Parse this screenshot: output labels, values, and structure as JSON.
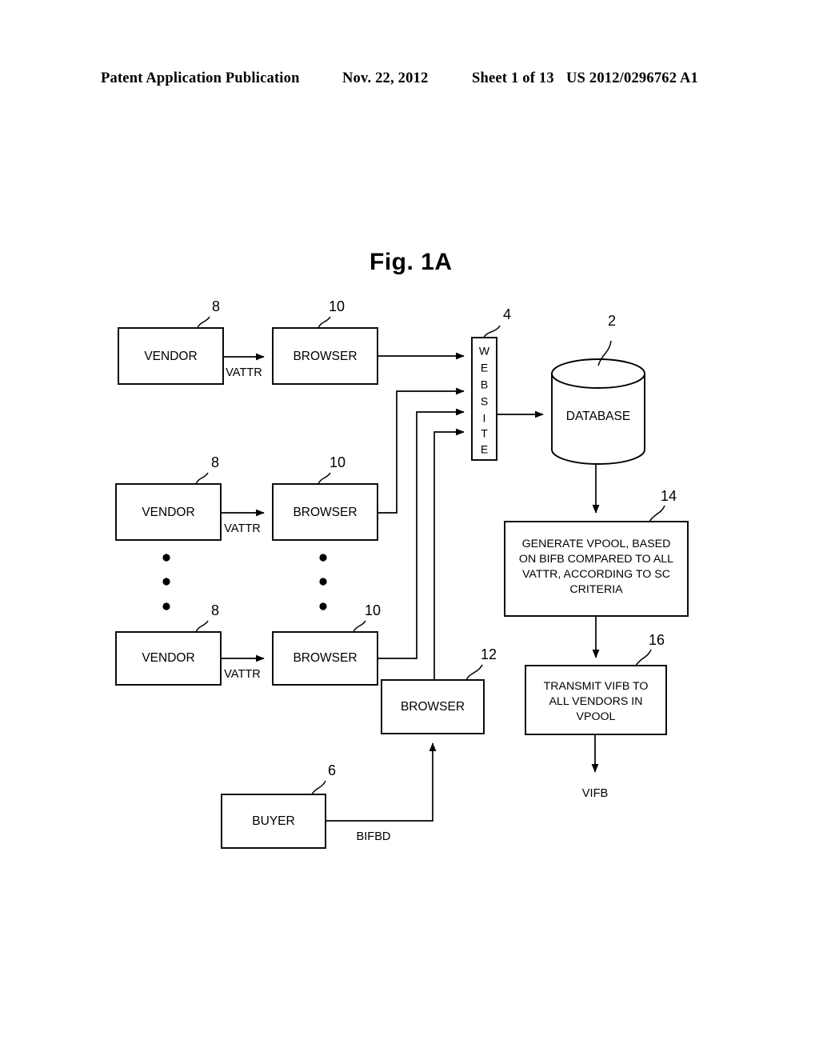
{
  "header": {
    "publication": "Patent Application Publication",
    "date": "Nov. 22, 2012",
    "sheet": "Sheet 1 of 13",
    "patent_number": "US 2012/0296762 A1"
  },
  "figure": {
    "title": "Fig. 1A",
    "nodes": {
      "vendor1": {
        "label": "VENDOR",
        "ref": "8"
      },
      "vendor2": {
        "label": "VENDOR",
        "ref": "8"
      },
      "vendor3": {
        "label": "VENDOR",
        "ref": "8"
      },
      "browser1": {
        "label": "BROWSER",
        "ref": "10"
      },
      "browser2": {
        "label": "BROWSER",
        "ref": "10"
      },
      "browser3": {
        "label": "BROWSER",
        "ref": "10"
      },
      "browser_buyer": {
        "label": "BROWSER",
        "ref": "12"
      },
      "website": {
        "label": "WEBSITE",
        "ref": "4"
      },
      "database": {
        "label": "DATABASE",
        "ref": "2"
      },
      "buyer": {
        "label": "BUYER",
        "ref": "6"
      },
      "generate_vpool": {
        "ref": "14",
        "lines": [
          "GENERATE VPOOL, BASED",
          "ON BIFB COMPARED TO ALL",
          "VATTR, ACCORDING TO SC",
          "CRITERIA"
        ]
      },
      "transmit_vifb": {
        "ref": "16",
        "lines": [
          "TRANSMIT VIFB TO",
          "ALL VENDORS IN",
          "VPOOL"
        ]
      }
    },
    "edge_labels": {
      "vattr1": "VATTR",
      "vattr2": "VATTR",
      "vattr3": "VATTR",
      "bifbd": "BIFBD",
      "vifb_out": "VIFB"
    },
    "website_letters": [
      "W",
      "E",
      "B",
      "S",
      "I",
      "T",
      "E"
    ]
  },
  "chart_data": {
    "type": "diagram",
    "title": "Fig. 1A",
    "nodes": [
      {
        "id": "8a",
        "label": "VENDOR",
        "ref": "8",
        "shape": "rect"
      },
      {
        "id": "10a",
        "label": "BROWSER",
        "ref": "10",
        "shape": "rect"
      },
      {
        "id": "8b",
        "label": "VENDOR",
        "ref": "8",
        "shape": "rect"
      },
      {
        "id": "10b",
        "label": "BROWSER",
        "ref": "10",
        "shape": "rect"
      },
      {
        "id": "8c",
        "label": "VENDOR",
        "ref": "8",
        "shape": "rect"
      },
      {
        "id": "10c",
        "label": "BROWSER",
        "ref": "10",
        "shape": "rect"
      },
      {
        "id": "12",
        "label": "BROWSER",
        "ref": "12",
        "shape": "rect"
      },
      {
        "id": "6",
        "label": "BUYER",
        "ref": "6",
        "shape": "rect"
      },
      {
        "id": "4",
        "label": "WEBSITE",
        "ref": "4",
        "shape": "rect-vertical-text"
      },
      {
        "id": "2",
        "label": "DATABASE",
        "ref": "2",
        "shape": "cylinder"
      },
      {
        "id": "14",
        "label": "GENERATE VPOOL, BASED ON BIFB COMPARED TO ALL VATTR, ACCORDING TO SC CRITERIA",
        "ref": "14",
        "shape": "rect"
      },
      {
        "id": "16",
        "label": "TRANSMIT VIFB TO ALL VENDORS IN VPOOL",
        "ref": "16",
        "shape": "rect"
      }
    ],
    "edges": [
      {
        "from": "8a",
        "to": "10a",
        "label": "VATTR"
      },
      {
        "from": "8b",
        "to": "10b",
        "label": "VATTR"
      },
      {
        "from": "8c",
        "to": "10c",
        "label": "VATTR"
      },
      {
        "from": "10a",
        "to": "4",
        "label": ""
      },
      {
        "from": "10b",
        "to": "4",
        "label": ""
      },
      {
        "from": "10c",
        "to": "4",
        "label": ""
      },
      {
        "from": "12",
        "to": "4",
        "label": ""
      },
      {
        "from": "6",
        "to": "12",
        "label": "BIFBD"
      },
      {
        "from": "4",
        "to": "2",
        "label": ""
      },
      {
        "from": "2",
        "to": "14",
        "label": ""
      },
      {
        "from": "14",
        "to": "16",
        "label": ""
      },
      {
        "from": "16",
        "to": "out",
        "label": "VIFB"
      }
    ],
    "ellipsis": "three vertical dots between vendor rows and browser rows"
  }
}
